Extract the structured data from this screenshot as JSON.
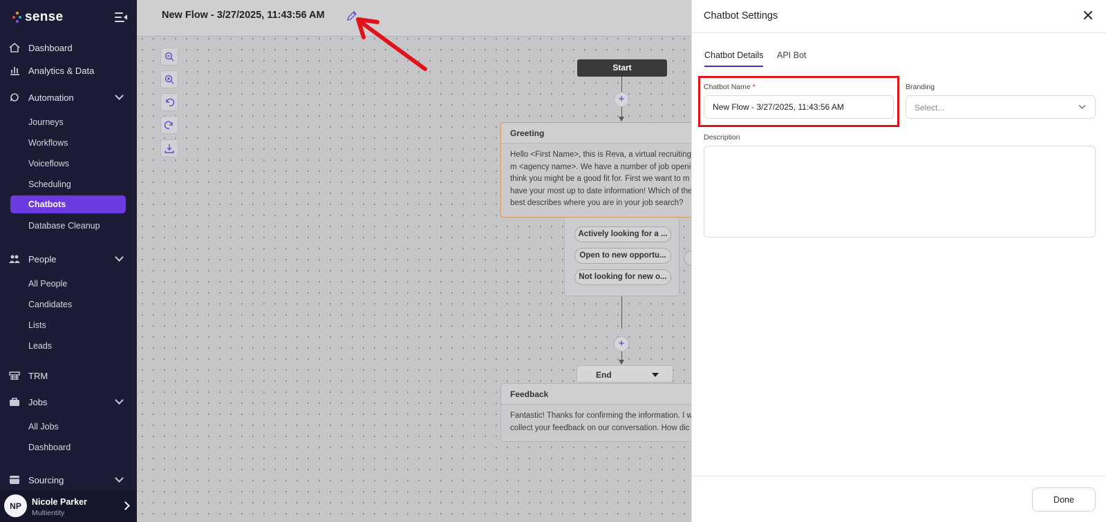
{
  "app": {
    "logo_text": "sense"
  },
  "sidebar": {
    "items": [
      {
        "label": "Dashboard",
        "icon": "home-icon"
      },
      {
        "label": "Analytics & Data",
        "icon": "bar-chart-icon"
      },
      {
        "label": "Automation",
        "icon": "automation-icon",
        "expanded": true
      },
      {
        "label": "People",
        "icon": "people-icon",
        "expanded": true
      },
      {
        "label": "TRM",
        "icon": "trm-icon"
      },
      {
        "label": "Jobs",
        "icon": "briefcase-icon",
        "expanded": true
      },
      {
        "label": "Sourcing",
        "icon": "sourcing-icon",
        "expanded": true
      }
    ],
    "automation_sub": [
      "Journeys",
      "Workflows",
      "Voiceflows",
      "Scheduling",
      "Chatbots",
      "Database Cleanup"
    ],
    "active_sub": "Chatbots",
    "people_sub": [
      "All People",
      "Candidates",
      "Lists",
      "Leads"
    ],
    "jobs_sub": [
      "All Jobs",
      "Dashboard"
    ],
    "user": {
      "initials": "NP",
      "name": "Nicole Parker",
      "org": "Multientity"
    }
  },
  "canvas": {
    "flow_title": "New Flow - 3/27/2025, 11:43:56 AM",
    "tools": [
      "zoom-out-icon",
      "zoom-in-icon",
      "undo-icon",
      "redo-icon",
      "download-icon"
    ],
    "start_label": "Start",
    "greeting": {
      "title": "Greeting",
      "lines": [
        "Hello <First Name>, this is Reva, a virtual recruiting a",
        "m <agency name>. We have a number of job openin",
        "think you might be a good fit for. First we want to m",
        "have your most up to date information! Which of the",
        "best describes where you are in your job search?"
      ]
    },
    "options": [
      "Actively looking for a ...",
      "Open to new opportu...",
      "Not looking for new o..."
    ],
    "end_label": "End",
    "feedback": {
      "title": "Feedback",
      "lines": [
        "Fantastic! Thanks for confirming the information. I w",
        "collect your feedback on our conversation. How dic"
      ]
    }
  },
  "panel": {
    "title": "Chatbot Settings",
    "tabs": [
      {
        "label": "Chatbot Details",
        "active": true
      },
      {
        "label": "API Bot",
        "active": false
      }
    ],
    "name_label": "Chatbot Name",
    "required_mark": "*",
    "name_value": "New Flow - 3/27/2025, 11:43:56 AM",
    "branding_label": "Branding",
    "branding_placeholder": "Select...",
    "description_label": "Description",
    "description_value": "",
    "done_label": "Done"
  },
  "colors": {
    "sidebar_bg": "#1b1b35",
    "accent": "#6b3ae0",
    "highlight": "#e0131a",
    "tab_underline": "#4b2ed6"
  }
}
